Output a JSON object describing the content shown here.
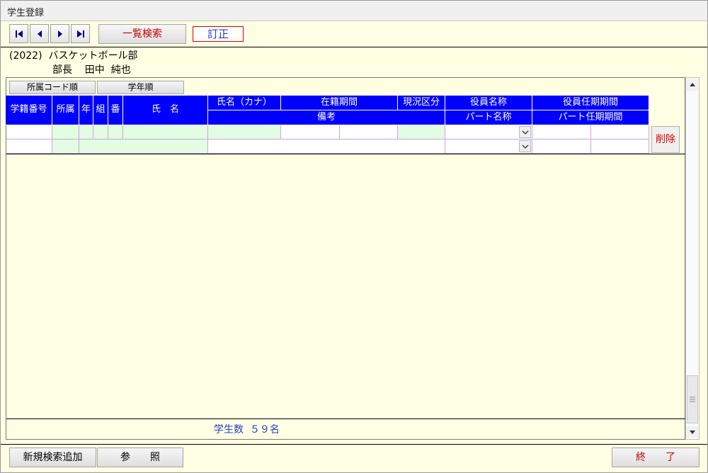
{
  "window": {
    "title": "学生登録"
  },
  "toolbar": {
    "first_icon": "first-record-icon",
    "prev_icon": "previous-record-icon",
    "next_icon": "next-record-icon",
    "last_icon": "last-record-icon",
    "search_label": "一覧検索",
    "mode_label": "訂正"
  },
  "club": {
    "line1": "(2022)  バスケットボール部",
    "line2": "部長    田中  純也"
  },
  "sort_buttons": {
    "by_code": "所属コード順",
    "by_year": "学年順"
  },
  "table": {
    "headers": {
      "student_no": "学籍番号",
      "affiliation": "所属",
      "year": "年",
      "class": "組",
      "number": "番",
      "name": "氏　名",
      "kana": "氏名（カナ）",
      "enroll_period": "在籍期間",
      "status": "現況区分",
      "officer_name": "役員名称",
      "officer_term": "役員任期期間",
      "remarks": "備考",
      "part_name": "パート名称",
      "part_term": "パート任期期間"
    },
    "delete_label": "削除"
  },
  "footer": {
    "student_count": "学生数  ５９名",
    "new_search_add": "新規検索追加",
    "reference": "参　　照",
    "exit": "終　　了"
  },
  "colors": {
    "header_blue": "#0000ff",
    "background": "#ffffe3",
    "cell_green": "#e2fde2",
    "accent_red": "#c00000",
    "text_blue": "#1f3fd0"
  }
}
